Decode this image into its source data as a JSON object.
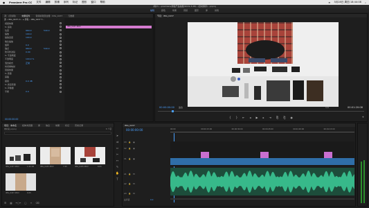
{
  "menubar": {
    "app_name": "Premiere Pro CC",
    "items": [
      "文件",
      "编辑",
      "剪辑",
      "序列",
      "标记",
      "图形",
      "窗口",
      "帮助"
    ],
    "clock": "3月28日 周四 18:44:08"
  },
  "titlebar": {
    "text": "/用户/...-premiere/通俗产品拍摄/2019-3-28/.../自动保存/…prproj"
  },
  "workspaces": {
    "items": [
      "编辑",
      "颜色",
      "效果",
      "音频",
      "图形",
      "库",
      "剪辑"
    ],
    "active": "编辑"
  },
  "effect_controls": {
    "tabs": [
      "源：(无剪辑)",
      "效果控件",
      "音频剪辑混合器：IMG_0437",
      "元数据"
    ],
    "source_label": "源 • IMG_0437.m… ▸ 剪辑 • IMG_0437 T…",
    "clip_bar_label": "IMG_0437.MOV",
    "rows": [
      {
        "name": "视频效果",
        "v1": "",
        "v2": ""
      },
      {
        "name": "fx 运动",
        "v1": "",
        "v2": ""
      },
      {
        "name": "位置",
        "v1": "960.0",
        "v2": "540.0"
      },
      {
        "name": "缩放",
        "v1": "100.0",
        "v2": ""
      },
      {
        "name": "缩放宽度",
        "v1": "100.0",
        "v2": ""
      },
      {
        "name": "等比缩放",
        "v1": "",
        "v2": ""
      },
      {
        "name": "旋转",
        "v1": "0.0",
        "v2": ""
      },
      {
        "name": "锚点",
        "v1": "960.0",
        "v2": "540.0"
      },
      {
        "name": "防闪烁滤镜",
        "v1": "0.00",
        "v2": ""
      },
      {
        "name": "fx 不透明度",
        "v1": "",
        "v2": ""
      },
      {
        "name": "不透明度",
        "v1": "100.0 %",
        "v2": ""
      },
      {
        "name": "混合模式",
        "v1": "正常",
        "v2": ""
      },
      {
        "name": "时间重映射",
        "v1": "",
        "v2": ""
      },
      {
        "name": "音频效果",
        "v1": "",
        "v2": ""
      },
      {
        "name": "fx 音量",
        "v1": "",
        "v2": ""
      },
      {
        "name": "旁路",
        "v1": "",
        "v2": ""
      },
      {
        "name": "级别",
        "v1": "0.0 dB",
        "v2": ""
      },
      {
        "name": "fx 通道音量",
        "v1": "",
        "v2": ""
      },
      {
        "name": "fx 声像器",
        "v1": "",
        "v2": ""
      },
      {
        "name": "平衡",
        "v1": "0.0",
        "v2": ""
      }
    ],
    "footer_tc": "00:00:00:00"
  },
  "program": {
    "tab": "节目：IMG_0437",
    "timecode_left": "00:00:00:00",
    "fit": "适合",
    "ratio": "1/4",
    "timecode_right": "00:01:20:08"
  },
  "project": {
    "tabs": [
      "项目：未命名",
      "媒体浏览器",
      "库",
      "信息",
      "效果",
      "标记",
      "历史记录"
    ],
    "path": "未命名.prproj",
    "items_count": "5 个项",
    "search_placeholder": "",
    "thumbs": [
      {
        "name": "IMG_0437.MOV",
        "dur": "1:20:08"
      },
      {
        "name": "IMG_0433.MOV",
        "dur": "7:25"
      },
      {
        "name": "IMG_0435.MOV",
        "dur": "6:05"
      },
      {
        "name": "IMG_0437.MOV",
        "dur": "6:05"
      }
    ]
  },
  "timeline": {
    "tab": "IMG_0437",
    "timecode": "00:00:00:00",
    "ruler": [
      "00:00",
      "00:00:15:00",
      "00:00:30:00",
      "00:00:45:00",
      "00:01:00:00",
      "00:01:15:00"
    ],
    "tracks": [
      "V3",
      "V2",
      "V1",
      "A1",
      "A2",
      "A3",
      "主声道"
    ],
    "master": "0.0"
  },
  "colors": {
    "accent": "#4aa0ff",
    "clip_video": "#2f6ea8",
    "clip_graphic": "#c96fd0",
    "clip_audio": "#2fa77a"
  }
}
